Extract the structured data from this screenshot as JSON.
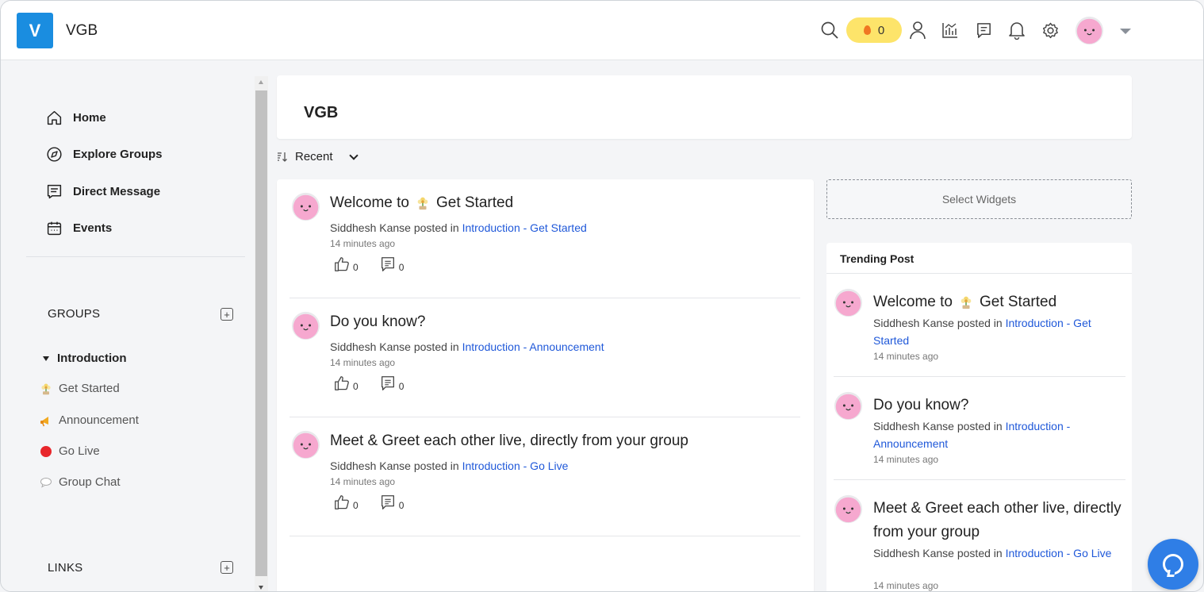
{
  "app": {
    "logo_letter": "V",
    "name": "VGB"
  },
  "topbar": {
    "icons": [
      "search-icon",
      "fire-streak-icon",
      "user-icon",
      "analytics-icon",
      "messages-icon",
      "bell-icon",
      "gear-icon",
      "avatar",
      "chevron-down-icon"
    ],
    "streak_count": "0",
    "colors": {
      "streak_bg": "#fde46a",
      "flame": "#f07722"
    }
  },
  "sidebar": {
    "nav": [
      {
        "label": "Home",
        "icon": "home-icon"
      },
      {
        "label": "Explore Groups",
        "icon": "compass-icon"
      },
      {
        "label": "Direct Message",
        "icon": "message-icon"
      },
      {
        "label": "Events",
        "icon": "calendar-icon"
      }
    ],
    "groups_title": "GROUPS",
    "group_name": "Introduction",
    "channels": [
      {
        "label": "Get Started",
        "icon": "flower-emoji-icon"
      },
      {
        "label": "Announcement",
        "icon": "megaphone-emoji-icon"
      },
      {
        "label": "Go Live",
        "icon": "red-circle-icon"
      },
      {
        "label": "Group Chat",
        "icon": "speech-bubble-icon"
      }
    ],
    "links_title": "LINKS"
  },
  "main": {
    "page_title": "VGB",
    "sort_label": "Recent",
    "posts": [
      {
        "title_pre": "Welcome to",
        "title_post": "Get Started",
        "has_emoji": true,
        "author": "Siddhesh Kanse",
        "posted_in": "posted in",
        "channel": "Introduction - Get Started",
        "time": "14 minutes ago",
        "likes": "0",
        "comments": "0"
      },
      {
        "title_pre": "Do you know?",
        "title_post": "",
        "has_emoji": false,
        "author": "Siddhesh Kanse",
        "posted_in": "posted in",
        "channel": "Introduction - Announcement",
        "time": "14 minutes ago",
        "likes": "0",
        "comments": "0"
      },
      {
        "title_pre": "Meet & Greet each other live, directly from your group",
        "title_post": "",
        "has_emoji": false,
        "author": "Siddhesh Kanse",
        "posted_in": "posted in",
        "channel": "Introduction - Go Live",
        "time": "14 minutes ago",
        "likes": "0",
        "comments": "0"
      }
    ]
  },
  "right": {
    "select_widgets": "Select Widgets",
    "trending_title": "Trending Post",
    "trending": [
      {
        "title_pre": "Welcome to",
        "title_post": "Get Started",
        "author": "Siddhesh Kanse",
        "posted_in": "posted in",
        "channel": "Introduction - Get Started",
        "time": "14 minutes ago"
      },
      {
        "title_pre": "Do you know?",
        "title_post": "",
        "author": "Siddhesh Kanse",
        "posted_in": "posted in",
        "channel": "Introduction - Announcement",
        "time": "14 minutes ago"
      },
      {
        "title_pre": "Meet & Greet each other live, directly from your group",
        "title_post": "",
        "author": "Siddhesh Kanse",
        "posted_in": "posted in",
        "channel": "Introduction - Go Live",
        "time": "14 minutes ago"
      }
    ]
  },
  "colors": {
    "accent": "#1a8de0",
    "link": "#1f58d9",
    "help_button": "#2f7ee6",
    "go_live": "#e8262b"
  }
}
